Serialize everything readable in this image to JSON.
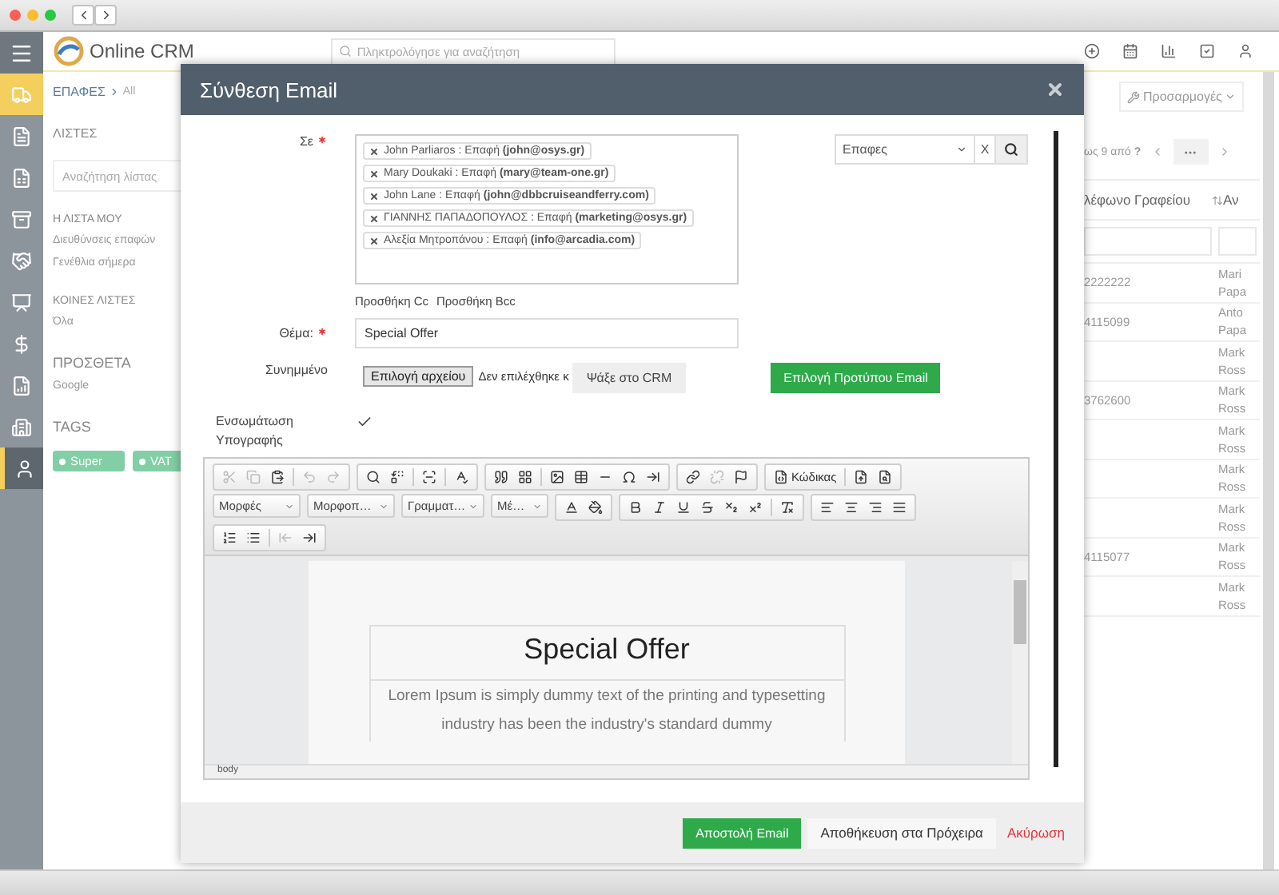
{
  "app": {
    "logo": "Online CRM",
    "search": {
      "placeholder": "Πληκτρολόγησε για αναζήτηση"
    }
  },
  "rail": [
    {
      "selected": true,
      "active": false
    },
    {
      "selected": false,
      "active": false
    },
    {
      "selected": false,
      "active": false
    },
    {
      "selected": false,
      "active": false
    },
    {
      "selected": false,
      "active": false
    },
    {
      "selected": false,
      "active": false
    },
    {
      "selected": false,
      "active": false
    },
    {
      "selected": false,
      "active": false
    },
    {
      "selected": false,
      "active": false
    },
    {
      "selected": false,
      "active": true
    }
  ],
  "breadcrumb": {
    "section": "ΕΠΑΦΕΣ",
    "current": "All"
  },
  "lists": {
    "title": "ΛΙΣΤΕΣ",
    "search": {
      "placeholder": "Αναζήτηση λίστας"
    },
    "groups": [
      {
        "title": "Η ΛΙΣΤΑ ΜΟΥ",
        "items": [
          "Διευθύνσεις επαφών",
          "Γενέθλια σήμερα"
        ]
      },
      {
        "title": "ΚΟΙΝΕΣ ΛΙΣΤΕΣ",
        "items": [
          "Όλα"
        ]
      },
      {
        "title": "ΠΡΟΣΘΕΤΑ",
        "items": [
          "Google"
        ]
      }
    ]
  },
  "tags": {
    "title": "TAGS",
    "items": [
      "Super",
      "VAT"
    ]
  },
  "records": {
    "customize": "Προσαρμογές",
    "pager": "ως 9 από **?**",
    "columns": [
      "λέφωνο Γραφείου",
      "Αν"
    ],
    "rows": [
      {
        "phone": "2222222",
        "name": "Mari Papa"
      },
      {
        "phone": "4115099",
        "name": "Anto Papa"
      },
      {
        "name": "Mark Ross"
      },
      {
        "phone": "3762600",
        "name": "Mark Ross"
      },
      {
        "name": "Mark Ross"
      },
      {
        "name": "Mark Ross"
      },
      {
        "name": "Mark Ross"
      },
      {
        "phone": "4115077",
        "name": "Mark Ross"
      },
      {
        "name": "Mark Ross"
      }
    ]
  },
  "compose": {
    "title": "Σύνθεση Email",
    "to": {
      "label": "Σε",
      "required": true,
      "recipients": [
        "John Parliaros : Επαφή **(john@osys.gr)**",
        "Mary Doukaki : Επαφή **(mary@team-one.gr)**",
        "John Lane : Επαφή **(john@dbbcruiseandferry.com)**",
        "ΓΙΑΝΝΗΣ ΠΑΠΑΔΟΠΟΥΛΟΣ : Επαφή **(marketing@osys.gr)**",
        "Αλεξία Μητροπάνου : Επαφή **(info@arcadia.com)**"
      ],
      "module_select": "Επαφες",
      "clear": "X"
    },
    "cc_links": [
      "Προσθήκη Cc",
      "Προσθήκη Bcc"
    ],
    "subject": {
      "label": "Θέμα:",
      "required": true,
      "value": "Special Offer"
    },
    "attachment": {
      "label": "Συνημμένο",
      "file_button": "Επιλογή αρχείου",
      "file_status": "Δεν επιλέχθηκε κ",
      "crm_button": "Ψάξε στο CRM"
    },
    "template_button": "Επιλογή Προτύπου Email",
    "signature": {
      "label": "Ενσωμάτωση Υπογραφής",
      "checked": true
    },
    "editor": {
      "source_button": "Κώδικας",
      "dropdowns": [
        "Μορφές",
        "Μορφοπ…",
        "Γραμματ…",
        "Μέ…"
      ],
      "content": {
        "heading": "Special Offer",
        "body": "Lorem Ipsum is simply dummy text of the printing and typesetting industry has been the industry's standard dummy"
      },
      "path": "body"
    },
    "actions": {
      "send": "Αποστολή Email",
      "draft": "Αποθήκευση στα Πρόχειρα",
      "cancel": "Ακύρωση"
    }
  }
}
